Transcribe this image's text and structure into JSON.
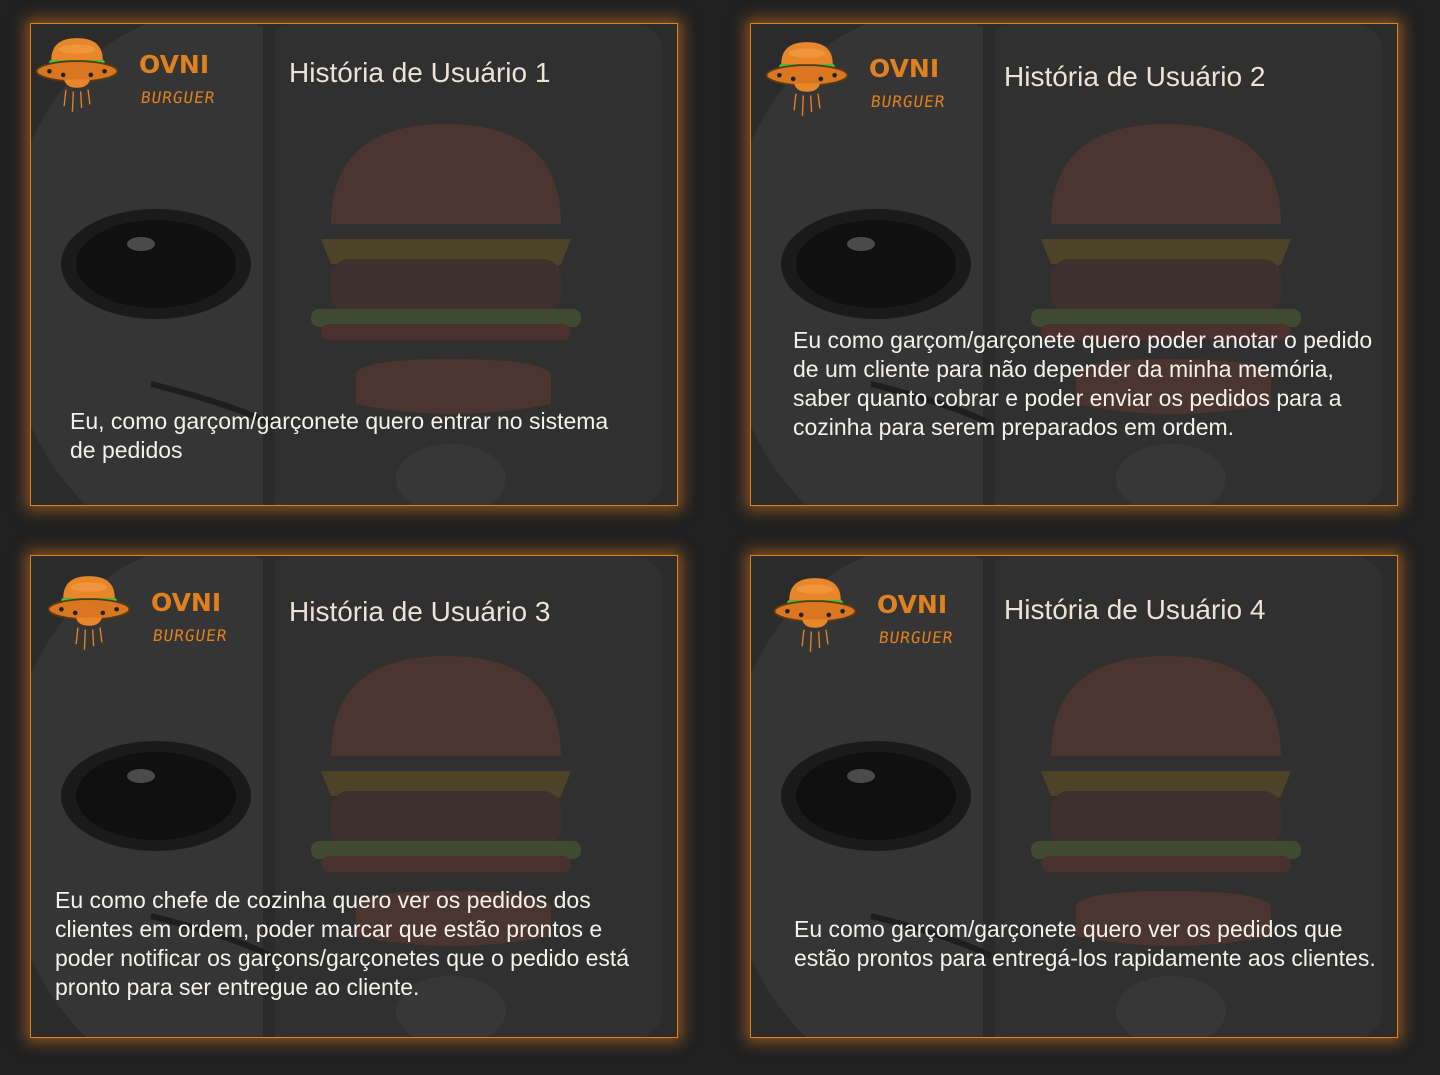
{
  "brand": {
    "name_top": "OVNI",
    "name_bottom": "BURGUER",
    "logo_icon": "ufo-burger-icon",
    "accent_color": "#e0801e",
    "background_image": "alien-face-with-burger-photo"
  },
  "cards": [
    {
      "title": "História de Usuário 1",
      "story": "Eu, como garçom/garçonete quero entrar no sistema de pedidos"
    },
    {
      "title": "História de Usuário 2",
      "story": "Eu como garçom/garçonete quero poder anotar o pedido de um cliente para não depender da minha memória, saber quanto cobrar e poder enviar os pedidos para a cozinha para serem preparados em ordem."
    },
    {
      "title": "História de Usuário 3",
      "story": "Eu como chefe de cozinha quero ver os pedidos dos clientes em ordem, poder marcar que estão prontos e poder notificar os garçons/garçonetes que o pedido está pronto para ser entregue ao cliente."
    },
    {
      "title": "História de Usuário 4",
      "story": "Eu como garçom/garçonete quero ver os pedidos que estão prontos para entregá-los rapidamente aos clientes."
    }
  ]
}
